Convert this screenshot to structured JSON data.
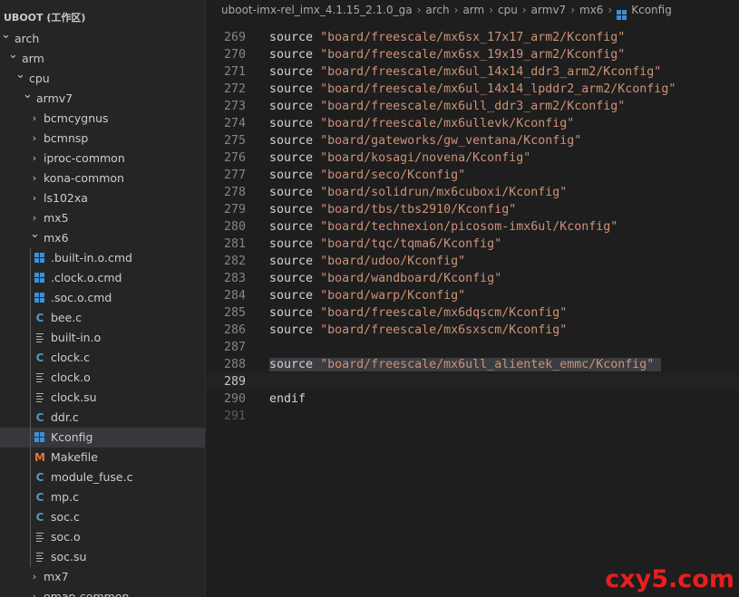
{
  "sidebar": {
    "title": "UBOOT (工作区)",
    "tree": [
      {
        "label": "arch",
        "expanded": true,
        "icon": "chevron-down-icon",
        "level": 0
      },
      {
        "label": "arm",
        "expanded": true,
        "icon": "chevron-down-icon",
        "level": 1
      },
      {
        "label": "cpu",
        "expanded": true,
        "icon": "chevron-down-icon",
        "level": 2
      },
      {
        "label": "armv7",
        "expanded": true,
        "icon": "chevron-down-icon",
        "level": 3
      },
      {
        "label": "bcmcygnus",
        "expanded": false,
        "icon": "chevron-right-icon",
        "level": 4
      },
      {
        "label": "bcmnsp",
        "expanded": false,
        "icon": "chevron-right-icon",
        "level": 4
      },
      {
        "label": "iproc-common",
        "expanded": false,
        "icon": "chevron-right-icon",
        "level": 4
      },
      {
        "label": "kona-common",
        "expanded": false,
        "icon": "chevron-right-icon",
        "level": 4
      },
      {
        "label": "ls102xa",
        "expanded": false,
        "icon": "chevron-right-icon",
        "level": 4
      },
      {
        "label": "mx5",
        "expanded": false,
        "icon": "chevron-right-icon",
        "level": 4
      },
      {
        "label": "mx6",
        "expanded": true,
        "icon": "chevron-down-icon",
        "level": 4
      },
      {
        "label": ".built-in.o.cmd",
        "icon": "windows-file-icon",
        "level": 5
      },
      {
        "label": ".clock.o.cmd",
        "icon": "windows-file-icon",
        "level": 5
      },
      {
        "label": ".soc.o.cmd",
        "icon": "windows-file-icon",
        "level": 5
      },
      {
        "label": "bee.c",
        "icon": "c-file-icon",
        "level": 5
      },
      {
        "label": "built-in.o",
        "icon": "text-file-icon",
        "level": 5
      },
      {
        "label": "clock.c",
        "icon": "c-file-icon",
        "level": 5
      },
      {
        "label": "clock.o",
        "icon": "text-file-icon",
        "level": 5
      },
      {
        "label": "clock.su",
        "icon": "text-file-icon",
        "level": 5
      },
      {
        "label": "ddr.c",
        "icon": "c-file-icon",
        "level": 5
      },
      {
        "label": "Kconfig",
        "icon": "windows-file-icon",
        "level": 5,
        "selected": true
      },
      {
        "label": "Makefile",
        "icon": "makefile-icon",
        "level": 5
      },
      {
        "label": "module_fuse.c",
        "icon": "c-file-icon",
        "level": 5
      },
      {
        "label": "mp.c",
        "icon": "c-file-icon",
        "level": 5
      },
      {
        "label": "soc.c",
        "icon": "c-file-icon",
        "level": 5
      },
      {
        "label": "soc.o",
        "icon": "text-file-icon",
        "level": 5
      },
      {
        "label": "soc.su",
        "icon": "text-file-icon",
        "level": 5
      },
      {
        "label": "mx7",
        "expanded": false,
        "icon": "chevron-right-icon",
        "level": 4
      },
      {
        "label": "omap-common",
        "expanded": false,
        "icon": "chevron-right-icon",
        "level": 4
      }
    ]
  },
  "breadcrumb": {
    "items": [
      "uboot-imx-rel_imx_4.1.15_2.1.0_ga",
      "arch",
      "arm",
      "cpu",
      "armv7",
      "mx6"
    ],
    "file": "Kconfig",
    "separator": "›"
  },
  "editor": {
    "current_line": 289,
    "lines": [
      {
        "num": "269",
        "kw": "source",
        "str": "\"board/freescale/mx6sx_17x17_arm2/Kconfig\""
      },
      {
        "num": "270",
        "kw": "source",
        "str": "\"board/freescale/mx6sx_19x19_arm2/Kconfig\""
      },
      {
        "num": "271",
        "kw": "source",
        "str": "\"board/freescale/mx6ul_14x14_ddr3_arm2/Kconfig\""
      },
      {
        "num": "272",
        "kw": "source",
        "str": "\"board/freescale/mx6ul_14x14_lpddr2_arm2/Kconfig\""
      },
      {
        "num": "273",
        "kw": "source",
        "str": "\"board/freescale/mx6ull_ddr3_arm2/Kconfig\""
      },
      {
        "num": "274",
        "kw": "source",
        "str": "\"board/freescale/mx6ullevk/Kconfig\""
      },
      {
        "num": "275",
        "kw": "source",
        "str": "\"board/gateworks/gw_ventana/Kconfig\""
      },
      {
        "num": "276",
        "kw": "source",
        "str": "\"board/kosagi/novena/Kconfig\""
      },
      {
        "num": "277",
        "kw": "source",
        "str": "\"board/seco/Kconfig\""
      },
      {
        "num": "278",
        "kw": "source",
        "str": "\"board/solidrun/mx6cuboxi/Kconfig\""
      },
      {
        "num": "279",
        "kw": "source",
        "str": "\"board/tbs/tbs2910/Kconfig\""
      },
      {
        "num": "280",
        "kw": "source",
        "str": "\"board/technexion/picosom-imx6ul/Kconfig\""
      },
      {
        "num": "281",
        "kw": "source",
        "str": "\"board/tqc/tqma6/Kconfig\""
      },
      {
        "num": "282",
        "kw": "source",
        "str": "\"board/udoo/Kconfig\""
      },
      {
        "num": "283",
        "kw": "source",
        "str": "\"board/wandboard/Kconfig\""
      },
      {
        "num": "284",
        "kw": "source",
        "str": "\"board/warp/Kconfig\""
      },
      {
        "num": "285",
        "kw": "source",
        "str": "\"board/freescale/mx6dqscm/Kconfig\""
      },
      {
        "num": "286",
        "kw": "source",
        "str": "\"board/freescale/mx6sxscm/Kconfig\""
      },
      {
        "num": "287",
        "kw": "",
        "str": ""
      },
      {
        "num": "288",
        "kw": "source",
        "str": "\"board/freescale/mx6ull_alientek_emmc/Kconfig\"",
        "highlight": true
      },
      {
        "num": "289",
        "kw": "",
        "str": ""
      },
      {
        "num": "290",
        "kw": "endif",
        "str": ""
      },
      {
        "num": "291",
        "kw": "",
        "str": "",
        "dim": true
      }
    ]
  },
  "watermark": "cxy5.com",
  "colors": {
    "editor_bg": "#1e1e1e",
    "sidebar_bg": "#252526",
    "selected_row": "#37373d",
    "string": "#ce9178",
    "keyword": "#d4d4d4",
    "line_number": "#858585",
    "watermark": "#e5201d"
  }
}
